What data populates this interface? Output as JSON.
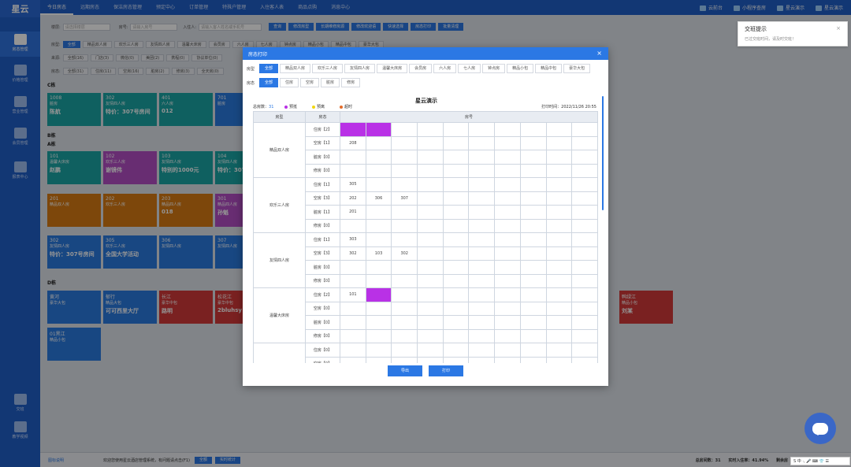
{
  "brand": {
    "logo": "星云"
  },
  "nav": {
    "tabs": [
      "今日房态",
      "远期房态",
      "保洁房态管理",
      "预定中心",
      "订单管理",
      "特殊户管理",
      "入住客人表",
      "商品点购",
      "消息中心"
    ]
  },
  "topright": {
    "cloud": "云前台",
    "mini": "小程序查房",
    "demo": "星云演示",
    "user": "星云演示"
  },
  "sidebar": [
    "房态管理",
    "价格管理",
    "营业管理",
    "会员管理",
    "报表中心",
    "交班",
    "教学视频"
  ],
  "background": {
    "search_label": "楼层:",
    "search_ph": "请选择楼层",
    "room_label": "房号:",
    "room_ph": "请输入房号",
    "guest_label": "入住人:",
    "guest_ph": "请输入客人姓名或手机号",
    "actions": [
      "查询",
      "修改房型",
      "长期维修房源",
      "修改欢迎语",
      "快速选择",
      "房态打印",
      "批量清理"
    ],
    "row1_label": "房型:",
    "row1": [
      "全部",
      "精品双人房",
      "欢乐三人房",
      "友情四人房",
      "温馨大床房",
      "会员房",
      "六人房",
      "七人房",
      "钟点房",
      "精品小包",
      "精品中包",
      "豪华大包"
    ],
    "row2_label": "来源:",
    "row2": [
      "全部(16)",
      "门店(3)",
      "微信(0)",
      "美团(2)",
      "携程(0)",
      "协议单位(0)"
    ],
    "row3_label": "房态:",
    "row3": [
      "全部(31)",
      "住房(11)",
      "空房(16)",
      "脏房(2)",
      "修房(3)",
      "全天房(0)"
    ],
    "sections": [
      "C栋",
      "B栋",
      "A栋",
      "D栋"
    ],
    "rooms": [
      {
        "num": "1008",
        "type": "脏房",
        "name": "陈航"
      },
      {
        "num": "302",
        "type": "友情四人房",
        "name": "特价：307号房间"
      },
      {
        "num": "401",
        "type": "六人房",
        "name": "012"
      },
      {
        "num": "701",
        "type": "脏房",
        "name": ""
      },
      {
        "num": "101",
        "type": "温馨大床房",
        "name": "赵鹏"
      },
      {
        "num": "102",
        "type": "欢乐三人房",
        "name": "谢镜伟"
      },
      {
        "num": "103",
        "type": "友情四人房",
        "name": "特别的1000元"
      },
      {
        "num": "104",
        "type": "友情四人房",
        "name": "特价：307"
      },
      {
        "num": "201",
        "type": "精品双人房",
        "name": ""
      },
      {
        "num": "202",
        "type": "欢乐三人房",
        "name": ""
      },
      {
        "num": "203",
        "type": "精品四人房",
        "name": "018"
      },
      {
        "num": "301",
        "type": "精品四人房",
        "name": "孙魁"
      },
      {
        "num": "302",
        "type": "友情四人房",
        "name": "特价：307号房间"
      },
      {
        "num": "305",
        "type": "欢乐三人房",
        "name": "全国大学活动"
      },
      {
        "num": "306",
        "type": "友情四人房",
        "name": ""
      },
      {
        "num": "307",
        "type": "友情四人房",
        "name": ""
      },
      {
        "num": "黄河",
        "type": "豪华大包",
        "name": ""
      },
      {
        "num": "郁行",
        "type": "精品大包",
        "name": "可可西里大厅"
      },
      {
        "num": "长江",
        "type": "豪华中包",
        "name": "路明"
      },
      {
        "num": "松花江",
        "type": "豪华中包",
        "name": "2bluhsy"
      },
      {
        "num": "鸭绿江",
        "type": "精品小包",
        "name": "刘某"
      },
      {
        "num": "01黑江",
        "type": "精品小包",
        "name": ""
      }
    ]
  },
  "notify": {
    "title": "交班提示",
    "msg": "已过交班时间，请及时交班！"
  },
  "bottom": {
    "link": "图标说明",
    "text": "欢迎您使用星云酒店管理系统，有问题请点击(F1)",
    "btn1": "全额",
    "btn2": "实时统计",
    "total_label": "总房间数：",
    "total": "31",
    "rate_label": "实时入住率：",
    "rate": "41.94%",
    "remain": "剩余房"
  },
  "ime": {
    "text": "S 中 ·, 🎤 ⌨ 👕 ☰"
  },
  "modal": {
    "title": "房态打印",
    "type_label": "房型",
    "types": [
      "全部",
      "精品双人房",
      "欢乐三人房",
      "友情四人房",
      "温馨大床房",
      "会员房",
      "六人房",
      "七人房",
      "钟点房",
      "精品小包",
      "精品中包",
      "豪华大包"
    ],
    "status_label": "房态",
    "statuses": [
      "全部",
      "住房",
      "空房",
      "脏房",
      "修房"
    ],
    "report_title": "星云演示",
    "total_label": "总房数：",
    "total": "31",
    "legend": [
      "预抵",
      "预离",
      "超时"
    ],
    "print_time": "打印时间：2022/11/26 20:55",
    "col_type": "房型",
    "col_status": "房态",
    "col_room": "房号",
    "groups": [
      {
        "name": "精品双人房",
        "rows": [
          {
            "s": "住房【2】",
            "cells": [
              "",
              ""
            ],
            "hl": [
              0,
              1
            ]
          },
          {
            "s": "空房【1】",
            "cells": [
              "208"
            ],
            "hl": []
          },
          {
            "s": "脏房【0】",
            "cells": [],
            "hl": []
          },
          {
            "s": "修房【0】",
            "cells": [],
            "hl": []
          }
        ]
      },
      {
        "name": "欢乐三人房",
        "rows": [
          {
            "s": "住房【1】",
            "cells": [
              "305"
            ],
            "hl": []
          },
          {
            "s": "空房【3】",
            "cells": [
              "202",
              "306",
              "307"
            ],
            "hl": []
          },
          {
            "s": "脏房【1】",
            "cells": [
              "201"
            ],
            "hl": []
          },
          {
            "s": "修房【0】",
            "cells": [],
            "hl": []
          }
        ]
      },
      {
        "name": "友情四人房",
        "rows": [
          {
            "s": "住房【1】",
            "cells": [
              "303"
            ],
            "hl": []
          },
          {
            "s": "空房【3】",
            "cells": [
              "302",
              "103",
              "302"
            ],
            "hl": []
          },
          {
            "s": "脏房【0】",
            "cells": [],
            "hl": []
          },
          {
            "s": "修房【0】",
            "cells": [],
            "hl": []
          }
        ]
      },
      {
        "name": "温馨大床房",
        "rows": [
          {
            "s": "住房【2】",
            "cells": [
              "101",
              ""
            ],
            "hl": [
              1
            ]
          },
          {
            "s": "空房【0】",
            "cells": [],
            "hl": []
          },
          {
            "s": "脏房【0】",
            "cells": [],
            "hl": []
          },
          {
            "s": "修房【0】",
            "cells": [],
            "hl": []
          }
        ]
      },
      {
        "name": "",
        "rows": [
          {
            "s": "住房【0】",
            "cells": [],
            "hl": []
          },
          {
            "s": "空房【0】",
            "cells": [],
            "hl": []
          }
        ]
      }
    ],
    "btn_export": "导出",
    "btn_print": "打印"
  },
  "colors": {
    "primary": "#2b78e4",
    "highlight": "#b931e6",
    "legend": [
      "#b931e6",
      "#f2d70f",
      "#e46c2a"
    ]
  }
}
